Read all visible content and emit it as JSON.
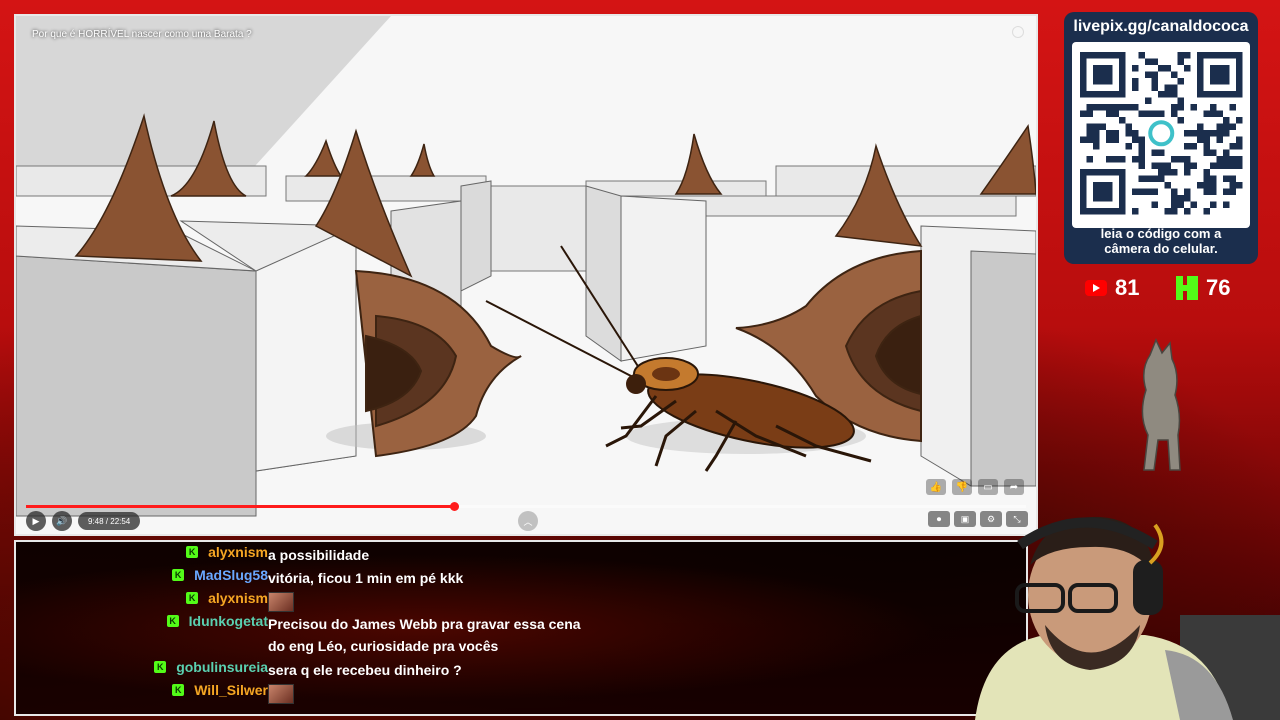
{
  "video": {
    "title": "Por que é HORRÍVEL nascer como uma Barata ?",
    "time": "9:48 / 22:54",
    "progress_fraction": 0.428
  },
  "player_controls": {
    "play_icon": "play-icon",
    "volume_icon": "volume-icon",
    "actions": [
      "thumbs-up-icon",
      "thumbs-down-icon",
      "comment-icon",
      "share-icon"
    ],
    "right": [
      "autoplay-toggle-icon",
      "subtitles-icon",
      "settings-icon",
      "fullscreen-exit-icon"
    ]
  },
  "qr": {
    "url": "livepix.gg/canaldococa",
    "caption_line1": "leia o código com a",
    "caption_line2": "câmera do celular."
  },
  "counters": {
    "youtube": "81",
    "kick": "76"
  },
  "colors": {
    "accent_red": "#ff1c1c",
    "kick_green": "#53fc18",
    "qr_panel": "#1b2e4d"
  },
  "chat": [
    {
      "user": "alyxnism",
      "color": "#f5a623",
      "message": "a possibilidade",
      "emote": false
    },
    {
      "user": "MadSlug58",
      "color": "#6aa8ff",
      "message": "vitória, ficou 1 min em pé kkk",
      "emote": false
    },
    {
      "user": "alyxnism",
      "color": "#f5a623",
      "message": "",
      "emote": true
    },
    {
      "user": "Idunkogetat",
      "color": "#5ad0b0",
      "message": "Precisou do James Webb pra gravar essa cena",
      "message2": "do eng Léo, curiosidade pra vocês",
      "emote": false
    },
    {
      "user": "gobulinsureia",
      "color": "#5ad0b0",
      "message": "sera q ele recebeu dinheiro ?",
      "emote": false
    },
    {
      "user": "Will_Silwer",
      "color": "#f5a623",
      "message": "",
      "emote": true
    }
  ]
}
